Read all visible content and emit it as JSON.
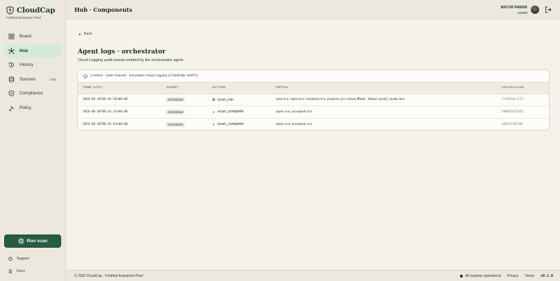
{
  "brand": {
    "name": "CloudCap",
    "subtitle": "Fortified Enterprise Pixel"
  },
  "sidebar": {
    "items": [
      {
        "label": "Board",
        "icon": "board-icon",
        "active": false
      },
      {
        "label": "Hub",
        "icon": "hub-icon",
        "active": true
      },
      {
        "label": "History",
        "icon": "history-icon",
        "active": false
      },
      {
        "label": "Sources",
        "icon": "database-icon",
        "count": "2/10",
        "active": false
      },
      {
        "label": "Compliance",
        "icon": "shield-check-icon",
        "active": false
      },
      {
        "label": "Policy",
        "icon": "scale-icon",
        "active": false
      }
    ],
    "run_scan_label": "Run scan",
    "support_label": "Support",
    "docs_label": "Docs"
  },
  "header": {
    "title": "Hub · Components",
    "user_name": "MAYUR PAWAR",
    "user_role": "ADMIN"
  },
  "main": {
    "back_label": "Back",
    "title": "Agent logs · orchestrator",
    "subtitle": "Cloud Logging audit events emitted by the orchestrator agent.",
    "card_note_prefix": "3 entries · hash-chained · immutable Cloud Logging (",
    "card_note_code": "cloudcap-audit",
    "card_note_suffix": ")",
    "columns": [
      "TIME (UTC)",
      "AGENT",
      "ACTION",
      "DETAIL",
      "CHAIN HASH"
    ],
    "rows": [
      {
        "time": "2026-08-30T06:01:50+00:00",
        "agent": "orchestrator",
        "action": "scan_run",
        "action_icon": "gear-icon",
        "detail": "new=0.0, open=5.0, resolved=0.0, projects=['cc-chaos-fff6da', 'kitearc-prod'], mode=live",
        "hash": "7c7015bc7123"
      },
      {
        "time": "2026-08-30T06:01:33+00:00",
        "agent": "orchestrator",
        "action": "scan_complete",
        "action_icon": "chevron-icon",
        "detail": "open=3.0, accepted=0.0",
        "hash": "5d0b67a51d55"
      },
      {
        "time": "2026-08-30T06:01:03+00:00",
        "agent": "orchestrator",
        "action": "scan_complete",
        "action_icon": "chevron-icon",
        "detail": "open=4.0, accepted=0.0",
        "hash": "d2615c50c581"
      }
    ]
  },
  "footer": {
    "copyright": "© 2026 CloudCap · Fortified Enterprise Pixel",
    "status": "All systems operational",
    "privacy": "Privacy",
    "terms": "Terms",
    "version": "v0.1.0"
  },
  "colors": {
    "brand_green": "#275d43",
    "active_nav": "#d5eadb",
    "role_green": "#2f7d54",
    "background": "#f5f2ea"
  }
}
